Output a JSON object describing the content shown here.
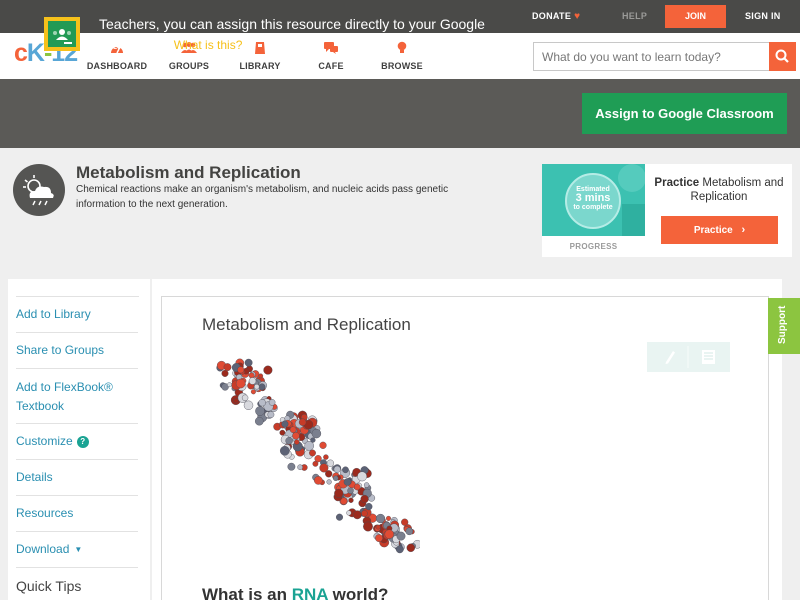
{
  "topbar": {
    "donate_label": "DONATE",
    "help_label": "HELP",
    "join_label": "JOIN",
    "signin_label": "SIGN IN"
  },
  "logo": {
    "c": "c",
    "k": "K",
    "dash": "-",
    "num": "12"
  },
  "nav": {
    "items": [
      {
        "label": "DASHBOARD",
        "icon": "dashboard-icon"
      },
      {
        "label": "GROUPS",
        "icon": "groups-icon"
      },
      {
        "label": "LIBRARY",
        "icon": "library-icon"
      },
      {
        "label": "CAFE",
        "icon": "cafe-icon"
      },
      {
        "label": "BROWSE",
        "icon": "browse-icon"
      }
    ]
  },
  "search": {
    "placeholder": "What do you want to learn today?",
    "icon": "search-icon"
  },
  "classroom": {
    "message": "Teachers, you can assign this resource directly to your Google Classroom!",
    "what_link": "What is this?",
    "assign_label": "Assign to Google Classroom"
  },
  "concept": {
    "title": "Metabolism and Replication",
    "description": "Chemical reactions make an organism's metabolism, and nucleic acids pass genetic information to the next generation.",
    "icon": "weather-cloud-icon"
  },
  "practice": {
    "estimated_label": "Estimated",
    "mins": "3 mins",
    "complete_label": "to complete",
    "progress_label": "PROGRESS",
    "heading_bold": "Practice",
    "heading_rest": "Metabolism and Replication",
    "button_label": "Practice"
  },
  "sidebar": {
    "items": [
      {
        "label": "Add to Library"
      },
      {
        "label": "Share to Groups"
      },
      {
        "label": "Add to FlexBook® Textbook"
      },
      {
        "label": "Customize"
      },
      {
        "label": "Details"
      },
      {
        "label": "Resources"
      },
      {
        "label": "Download"
      }
    ],
    "quick_tips": "Quick Tips"
  },
  "article": {
    "title": "Metabolism and Replication",
    "h2_prefix": "What is an ",
    "h2_rna": "RNA",
    "h2_suffix": " world?"
  },
  "support_label": "Support",
  "colors": {
    "accent": "#f4633a",
    "link": "#2a8fb1",
    "teal": "#1aa393",
    "green": "#1f9d55",
    "support": "#8cc540"
  }
}
